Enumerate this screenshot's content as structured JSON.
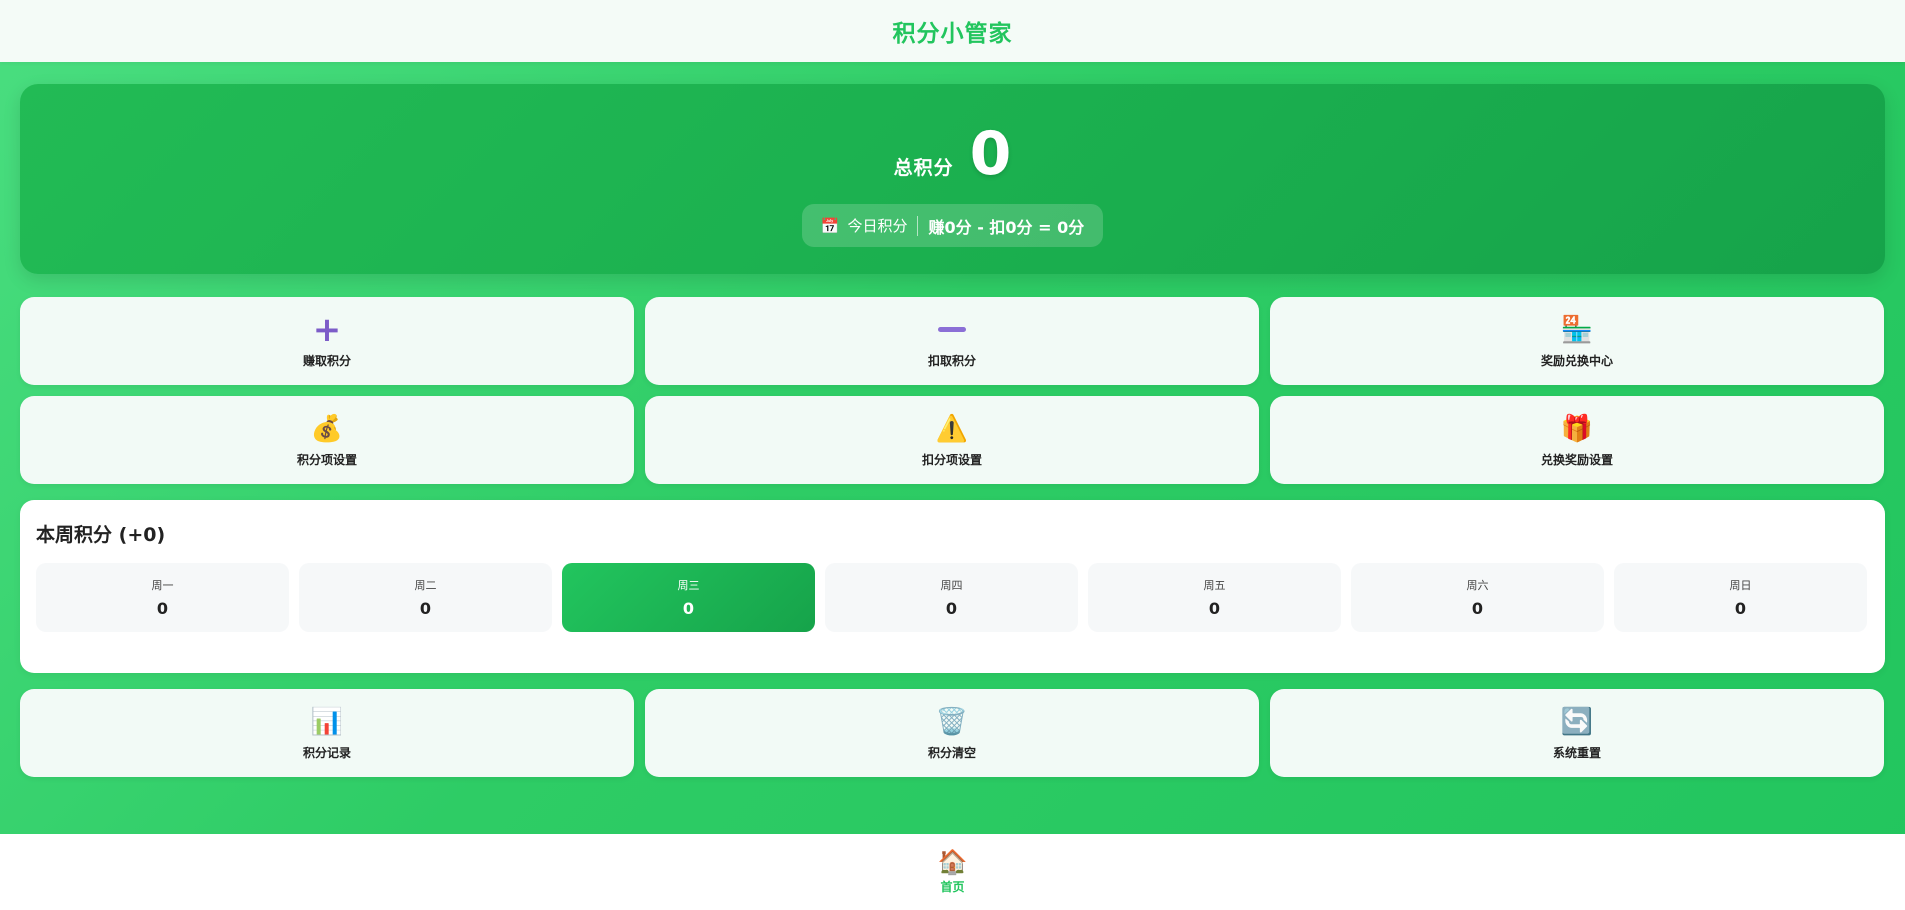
{
  "app": {
    "title": "积分小管家"
  },
  "score": {
    "label": "总积分",
    "value": "0",
    "today": {
      "icon": "calendar-icon",
      "label": "今日积分",
      "formula": "赚0分 - 扣0分 = 0分"
    }
  },
  "actions": [
    {
      "label": "赚取积分",
      "icon": "plus-icon"
    },
    {
      "label": "扣取积分",
      "icon": "minus-icon"
    },
    {
      "label": "奖励兑换中心",
      "icon": "store-icon",
      "glyph": "🏪"
    },
    {
      "label": "积分项设置",
      "icon": "money-bag-icon",
      "glyph": "💰"
    },
    {
      "label": "扣分项设置",
      "icon": "warning-icon",
      "glyph": "⚠️"
    },
    {
      "label": "兑换奖励设置",
      "icon": "gift-icon",
      "glyph": "🎁"
    }
  ],
  "week": {
    "title": "本周积分",
    "delta": "(+0)",
    "days": [
      {
        "name": "周一",
        "value": "0"
      },
      {
        "name": "周二",
        "value": "0"
      },
      {
        "name": "周三",
        "value": "0",
        "active": true
      },
      {
        "name": "周四",
        "value": "0"
      },
      {
        "name": "周五",
        "value": "0"
      },
      {
        "name": "周六",
        "value": "0"
      },
      {
        "name": "周日",
        "value": "0"
      }
    ]
  },
  "tools": [
    {
      "label": "积分记录",
      "icon": "bar-chart-icon",
      "glyph": "📊"
    },
    {
      "label": "积分清空",
      "icon": "trash-icon",
      "glyph": "🗑️"
    },
    {
      "label": "系统重置",
      "icon": "refresh-icon",
      "glyph": "🔄"
    }
  ],
  "nav": {
    "home_label": "首页",
    "home_icon": "home-icon",
    "home_glyph": "🏠"
  },
  "colors": {
    "primary": "#22c55e",
    "primary_dark": "#16a34a",
    "card_bg": "#f2faf6"
  }
}
